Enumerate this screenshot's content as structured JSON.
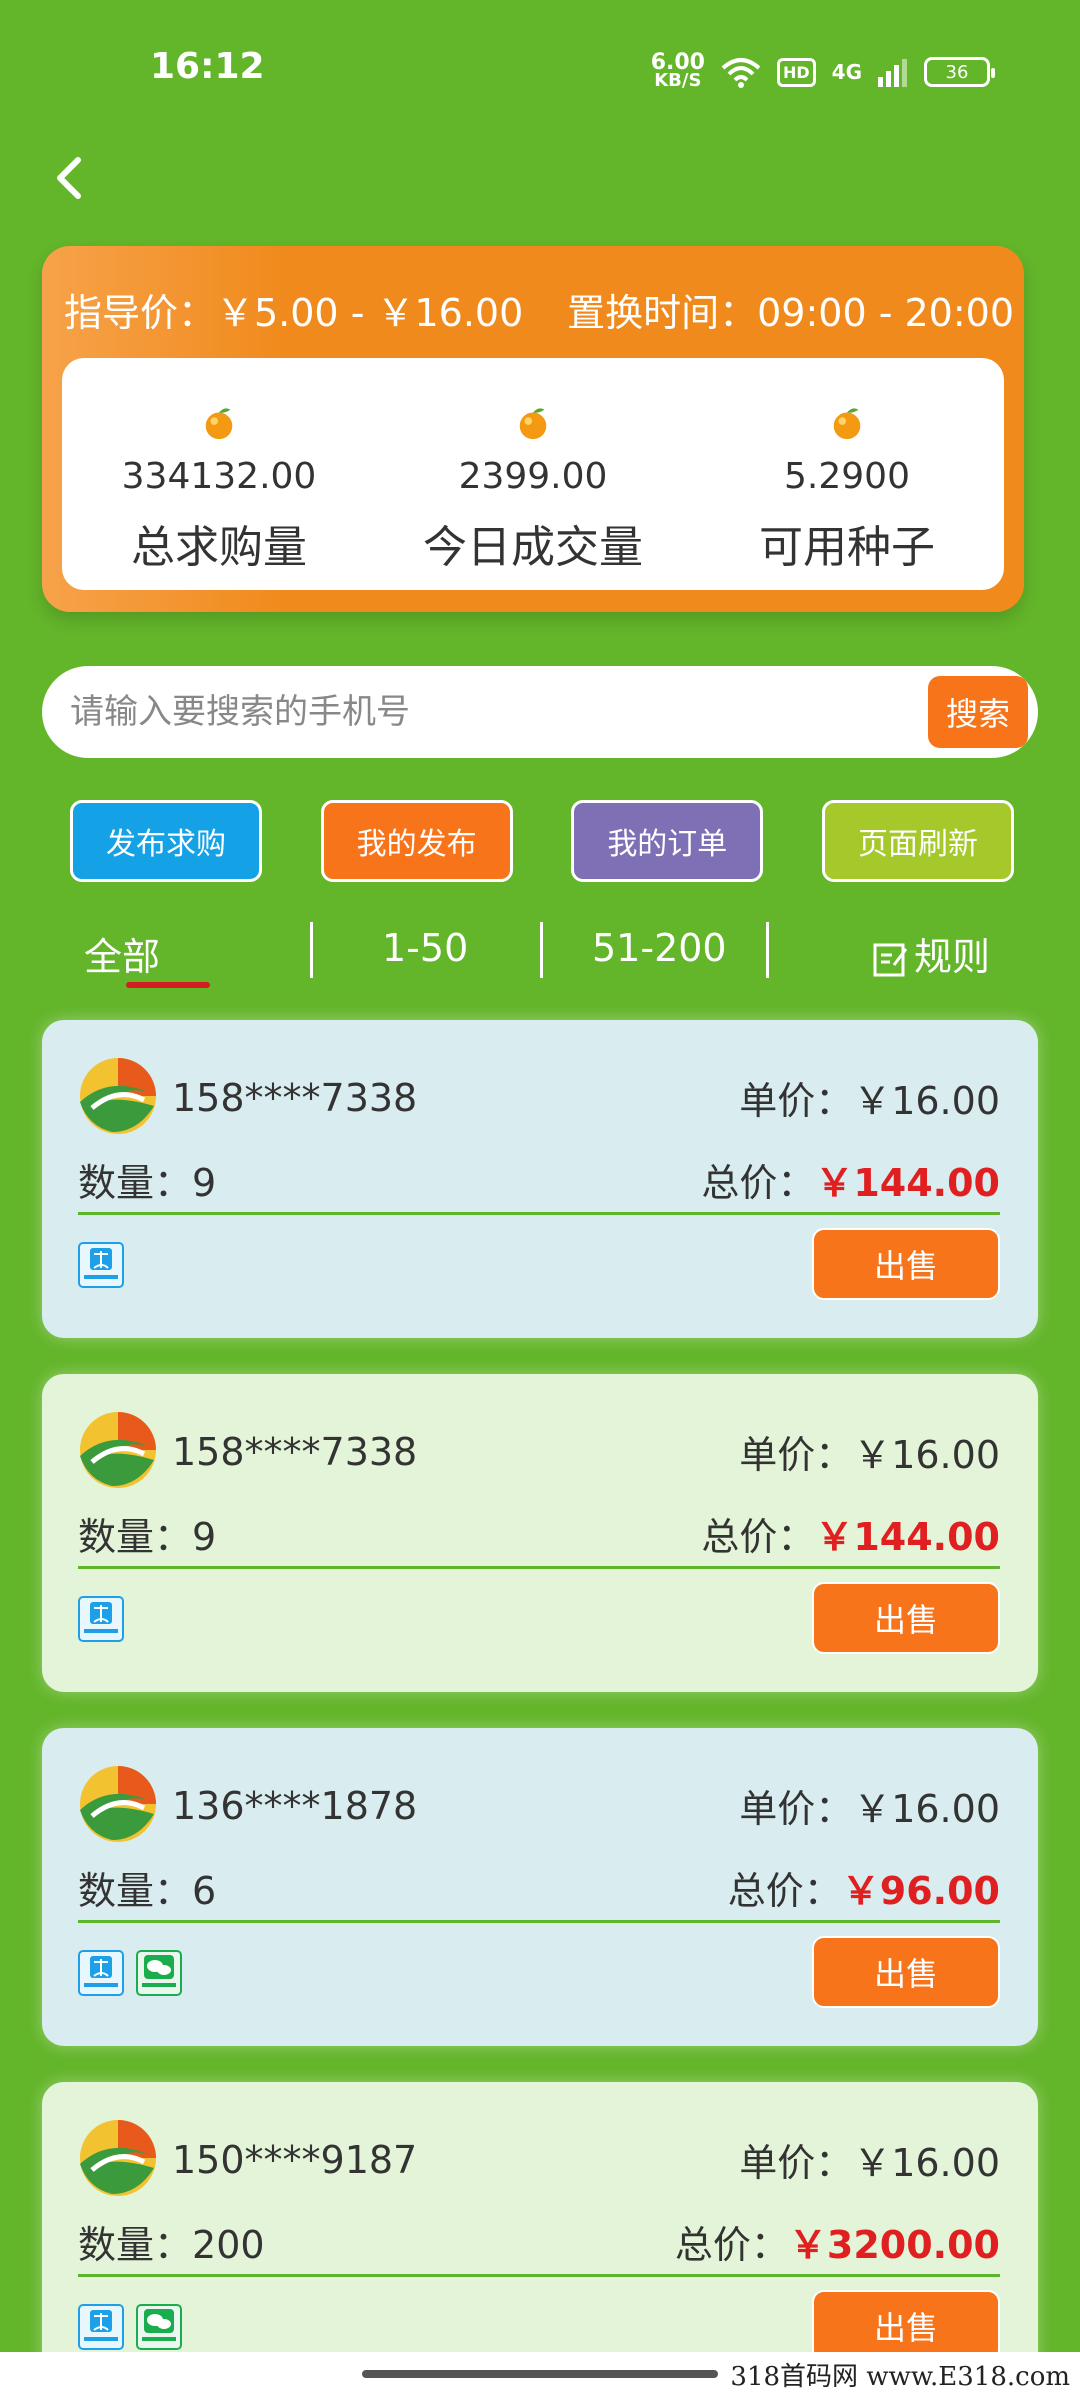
{
  "status": {
    "time": "16:12",
    "net_speed_value": "6.00",
    "net_speed_unit": "KB/S",
    "hd": "HD",
    "signal": "4G",
    "battery": "36"
  },
  "info": {
    "guide_price": "指导价：￥5.00 - ￥16.00",
    "swap_time": "置换时间：09:00 - 20:00",
    "stats": [
      {
        "value": "334132.00",
        "label": "总求购量"
      },
      {
        "value": "2399.00",
        "label": "今日成交量"
      },
      {
        "value": "5.2900",
        "label": "可用种子"
      }
    ]
  },
  "search": {
    "placeholder": "请输入要搜索的手机号",
    "button": "搜索"
  },
  "actions": {
    "publish_buy": "发布求购",
    "my_posts": "我的发布",
    "my_orders": "我的订单",
    "refresh": "页面刷新"
  },
  "tabs": {
    "all": "全部",
    "range1": "1-50",
    "range2": "51-200",
    "rules": "规则"
  },
  "labels": {
    "unit_price": "单价：",
    "quantity": "数量：",
    "total": "总价：",
    "sell": "出售"
  },
  "orders": [
    {
      "phone": "158****7338",
      "unit_price": "￥16.00",
      "quantity": "9",
      "total": "￥144.00"
    },
    {
      "phone": "158****7338",
      "unit_price": "￥16.00",
      "quantity": "9",
      "total": "￥144.00"
    },
    {
      "phone": "136****1878",
      "unit_price": "￥16.00",
      "quantity": "6",
      "total": "￥96.00"
    },
    {
      "phone": "150****9187",
      "unit_price": "￥16.00",
      "quantity": "200",
      "total": "￥3200.00"
    }
  ],
  "watermark": "318首码网 www.E318.com",
  "colors": {
    "background": "#63b52a",
    "orange": "#f08a1c",
    "sell": "#f7741a",
    "publish": "#14a1e6",
    "my_posts": "#f7741a",
    "my_orders": "#7f6fb4",
    "refresh": "#a5c92a",
    "price_red": "#e02020"
  }
}
